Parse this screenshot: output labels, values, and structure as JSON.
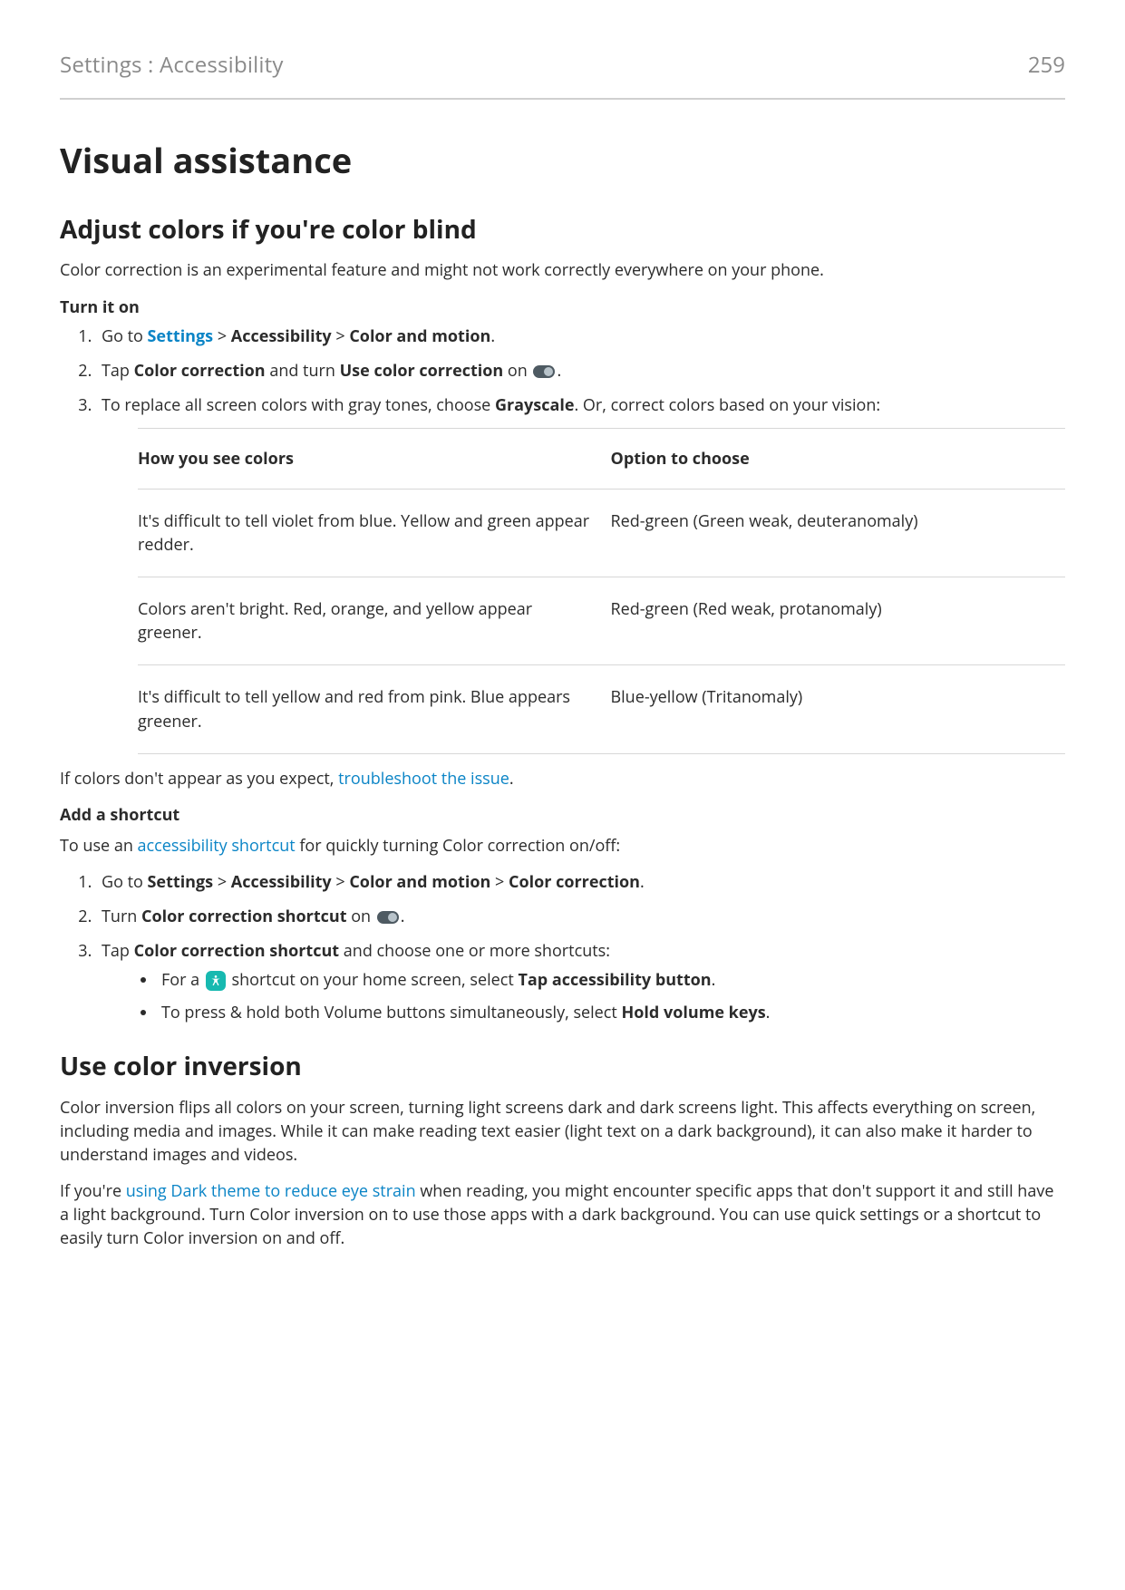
{
  "header": {
    "breadcrumb": "Settings : Accessibility",
    "page_number": "259"
  },
  "h1": "Visual assistance",
  "section1": {
    "h2": "Adjust colors if you're color blind",
    "intro": "Color correction is an experimental feature and might not work correctly everywhere on your phone.",
    "subhead_on": "Turn it on",
    "step1": {
      "pre": "Go to ",
      "settings_link": "Settings",
      "sep1": " > ",
      "accessibility": "Accessibility",
      "sep2": " > ",
      "colormotion": "Color and motion",
      "period": "."
    },
    "step2": {
      "pre": "Tap ",
      "cc": "Color correction",
      "and": " and turn ",
      "use_cc": "Use color correction",
      "on": " on ",
      "period": "."
    },
    "step3": {
      "pre": "To replace all screen colors with gray tones, choose ",
      "grayscale": "Grayscale",
      "post": ". Or, correct colors based on your vision:"
    },
    "table": {
      "col1": "How you see colors",
      "col2": "Option to choose",
      "rows": [
        {
          "see": "It's difficult to tell violet from blue. Yellow and green appear redder.",
          "opt": "Red-green (Green weak, deuteranomaly)"
        },
        {
          "see": "Colors aren't bright. Red, orange, and yellow appear greener.",
          "opt": "Red-green (Red weak, protanomaly)"
        },
        {
          "see": "It's difficult to tell yellow and red from pink. Blue appears greener.",
          "opt": "Blue-yellow (Tritanomaly)"
        }
      ]
    },
    "troubleshoot": {
      "pre": "If colors don't appear as you expect, ",
      "link": "troubleshoot the issue",
      "post": "."
    },
    "subhead_shortcut": "Add a shortcut",
    "shortcut_intro": {
      "pre": "To use an ",
      "link": "accessibility shortcut",
      "post": " for quickly turning Color correction on/off:"
    },
    "sc_step1": {
      "pre": "Go to ",
      "settings": "Settings",
      "sep": " > ",
      "accessibility": "Accessibility",
      "colormotion": "Color and motion",
      "cc": "Color correction",
      "period": "."
    },
    "sc_step2": {
      "pre": "Turn ",
      "ccs": "Color correction shortcut",
      "on": " on ",
      "period": "."
    },
    "sc_step3": {
      "pre": "Tap ",
      "ccs": "Color correction shortcut",
      "post": " and choose one or more shortcuts:"
    },
    "sc_bullet_a": {
      "pre": "For a ",
      "mid": " shortcut on your home screen, select ",
      "tab": "Tap accessibility button",
      "period": "."
    },
    "sc_bullet_b": {
      "pre": "To press & hold both Volume buttons simultaneously, select ",
      "hvk": "Hold volume keys",
      "period": "."
    }
  },
  "section2": {
    "h2": "Use color inversion",
    "p1": "Color inversion flips all colors on your screen, turning light screens dark and dark screens light. This affects everything on screen, including media and images. While it can make reading text easier (light text on a dark background), it can also make it harder to understand images and videos.",
    "p2": {
      "pre": "If you're ",
      "link": "using Dark theme to reduce eye strain",
      "post": " when reading, you might encounter specific apps that don't support it and still have a light background. Turn Color inversion on to use those apps with a dark background. You can use quick settings or a shortcut to easily turn Color inversion on and off."
    }
  }
}
